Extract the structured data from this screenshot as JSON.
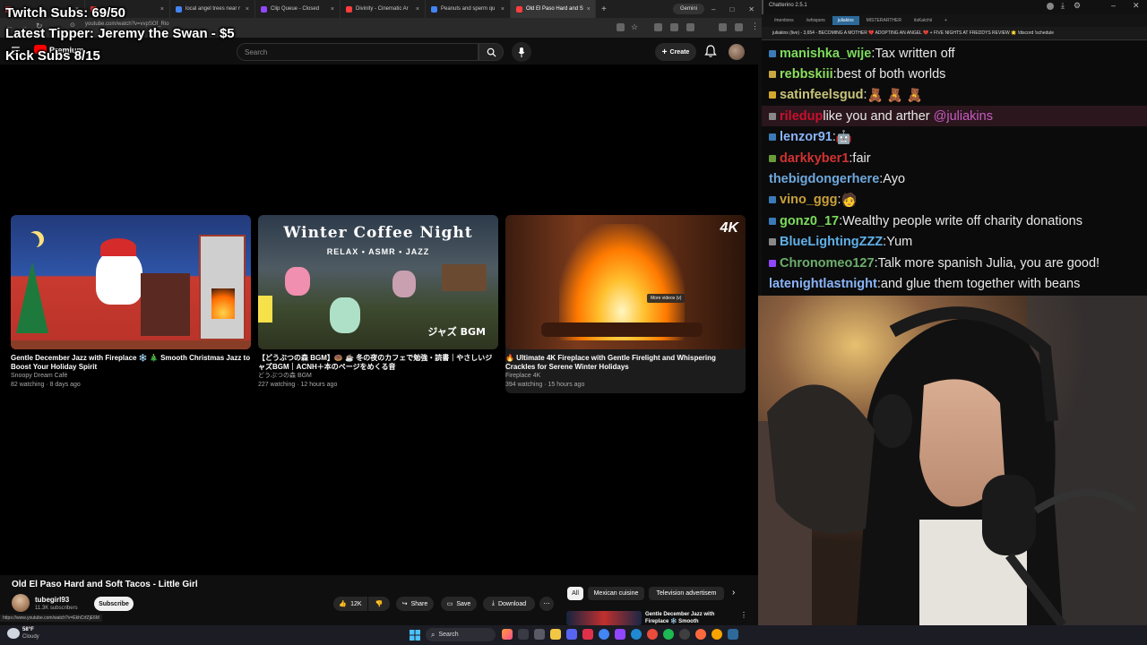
{
  "overlay": {
    "twitch_subs": "Twitch Subs: 69/50",
    "latest_tipper": "Latest Tipper: Jeremy the Swan - $5",
    "kick_subs": "Kick Subs 8/15"
  },
  "browser": {
    "tabs": [
      {
        "label": "",
        "color": "#ff3d3d"
      },
      {
        "label": "",
        "color": "#ff3d3d"
      },
      {
        "label": "local angel trees near r",
        "color": "#4285f4"
      },
      {
        "label": "Clip Queue - Closed",
        "color": "#9146ff"
      },
      {
        "label": "Divinity - Cinematic Ar",
        "color": "#ff3d3d"
      },
      {
        "label": "Peanuts and sperm qu",
        "color": "#4285f4"
      },
      {
        "label": "Old El Paso Hard and S",
        "color": "#ff3d3d"
      }
    ],
    "gemini_label": "Gemini",
    "url": "youtube.com/watch?v=vvpSOf_Rio"
  },
  "youtube": {
    "logo_text": "Premium",
    "search_placeholder": "Search",
    "create_label": "Create",
    "cards": [
      {
        "title": "Gentle December Jazz with Fireplace ❄️ 🎄 Smooth Christmas Jazz to Boost Your Holiday Spirit",
        "channel": "Snoopy Dream Café",
        "meta": "82 watching · 8 days ago"
      },
      {
        "title": "【どうぶつの森 BGM】🍩 ☕ 冬の夜のカフェで勉強・読書｜やさしいジャズBGM｜ACNH＋本のページをめくる音",
        "channel": "どうぶつの森 BGM",
        "meta": "227 watching · 12 hours ago",
        "thumb_title": "Winter Coffee Night",
        "thumb_sub": "RELAX • ASMR • JAZZ",
        "thumb_jp": "ジャズ BGM"
      },
      {
        "title": "🔥 Ultimate 4K Fireplace with Gentle Firelight and Whispering Crackles for Serene Winter Holidays",
        "channel": "Fireplace 4K",
        "meta": "394 watching · 15 hours ago",
        "thumb_badge": "4K"
      }
    ],
    "more_videos_tip": "More videos (v)",
    "video_title": "Old El Paso Hard and Soft Tacos - Little Girl",
    "channel_name": "tubegirl93",
    "channel_subs": "11.3K subscribers",
    "subscribe_label": "Subscribe",
    "like_count": "12K",
    "share_label": "Share",
    "save_label": "Save",
    "download_label": "Download",
    "chips": [
      "All",
      "Mexican cuisine",
      "Television advertisem"
    ],
    "status_url": "https://www.youtube.com/watch?v=EkhCrfZjE6M",
    "related_title": "Gentle December Jazz with Fireplace ❄️ Smooth"
  },
  "chat": {
    "app_title": "Chatterino 2.5.1",
    "tabs": [
      "/mentions",
      "/whispers",
      "juliakins",
      "MISTERARTHER",
      "itsKatchii"
    ],
    "active_tab": 2,
    "header": "juliakins (live) - 3,654 - BECOMING A MOTHER 💔 ADOPTING AN ANGEL 💔 + FIVE NIGHTS AT FREDDYS REVIEW 🌟 !discord !schedule",
    "messages": [
      {
        "nick": "manishka_wije",
        "text": "Tax written off",
        "color": "#7cdc5c",
        "badge": "#3b7ab8",
        "mention": "",
        "highlight": false
      },
      {
        "nick": "rebbskiii",
        "text": "best of both worlds",
        "color": "#8be05e",
        "badge": "#c9a640",
        "mention": "",
        "highlight": false
      },
      {
        "nick": "satinfeelsgud",
        "text": "🧸 🧸 🧸",
        "color": "#c9c47a",
        "badge": "#d4a72c",
        "mention": "",
        "highlight": false
      },
      {
        "nick": "riledup",
        "text": "like you and arther ",
        "color": "#c8102e",
        "badge": "#888888",
        "mention": "@juliakins",
        "highlight": true
      },
      {
        "nick": "lenzor91",
        "text": "🤖",
        "color": "#8ab4f8",
        "badge": "#3b7ab8",
        "mention": "",
        "highlight": false
      },
      {
        "nick": "darkkyber1",
        "text": "fair",
        "color": "#d13232",
        "badge": "#6a9a3a",
        "mention": "",
        "highlight": false
      },
      {
        "nick": "thebigdongerhere",
        "text": "Ayo",
        "color": "#6fa8dc",
        "badge": "",
        "mention": "",
        "highlight": false
      },
      {
        "nick": "vino_ggg",
        "text": "🧑",
        "color": "#c9a03a",
        "badge": "#3b7ab8",
        "mention": "",
        "highlight": false
      },
      {
        "nick": "gonz0_17",
        "text": "Wealthy people write off charity donations",
        "color": "#7cdc5c",
        "badge": "#3b7ab8",
        "mention": "",
        "highlight": false
      },
      {
        "nick": "BlueLightingZZZ",
        "text": "Yum",
        "color": "#5fb0e8",
        "badge": "#888888",
        "mention": "",
        "highlight": false
      },
      {
        "nick": "Chronomeo127",
        "text": "Talk more spanish Julia, you are good!",
        "color": "#6cae6c",
        "badge": "#9146ff",
        "mention": "",
        "highlight": false
      },
      {
        "nick": "latenightlastnight",
        "text": "and glue them together with beans",
        "color": "#8ab4f8",
        "badge": "",
        "mention": "",
        "highlight": false
      }
    ]
  },
  "taskbar": {
    "temperature": "58°F",
    "weather": "Cloudy",
    "search_label": "Search"
  }
}
